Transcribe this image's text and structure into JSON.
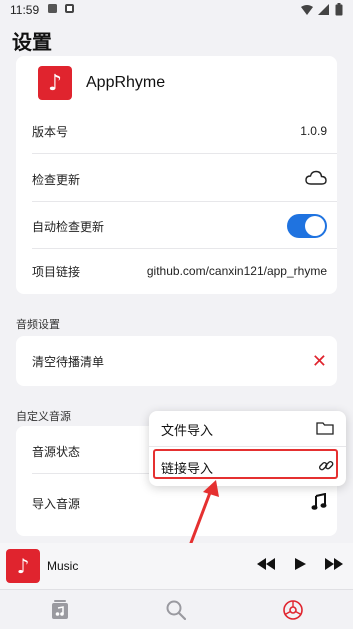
{
  "status_bar": {
    "time": "11:59"
  },
  "page_title": "设置",
  "app": {
    "name": "AppRhyme"
  },
  "rows": {
    "version_label": "版本号",
    "version_value": "1.0.9",
    "check_update_label": "检查更新",
    "auto_check_label": "自动检查更新",
    "auto_check_enabled": true,
    "project_link_label": "项目链接",
    "project_link_value": "github.com/canxin121/app_rhyme"
  },
  "audio_section": {
    "label": "音频设置",
    "clear_queue_label": "清空待播清单"
  },
  "source_section": {
    "label": "自定义音源",
    "status_label": "音源状态",
    "import_label": "导入音源"
  },
  "popup_menu": {
    "file_import": "文件导入",
    "link_import": "链接导入"
  },
  "player": {
    "title": "Music"
  },
  "colors": {
    "brand_red": "#e0242e",
    "toggle_blue": "#1f73e0",
    "annotation_red": "#e53030"
  },
  "icons": [
    "cloud-icon",
    "folder-icon",
    "link-icon",
    "music-note-icon",
    "close-icon",
    "rewind-icon",
    "play-icon",
    "fast-forward-icon",
    "library-tab-icon",
    "search-tab-icon",
    "settings-tab-icon"
  ]
}
